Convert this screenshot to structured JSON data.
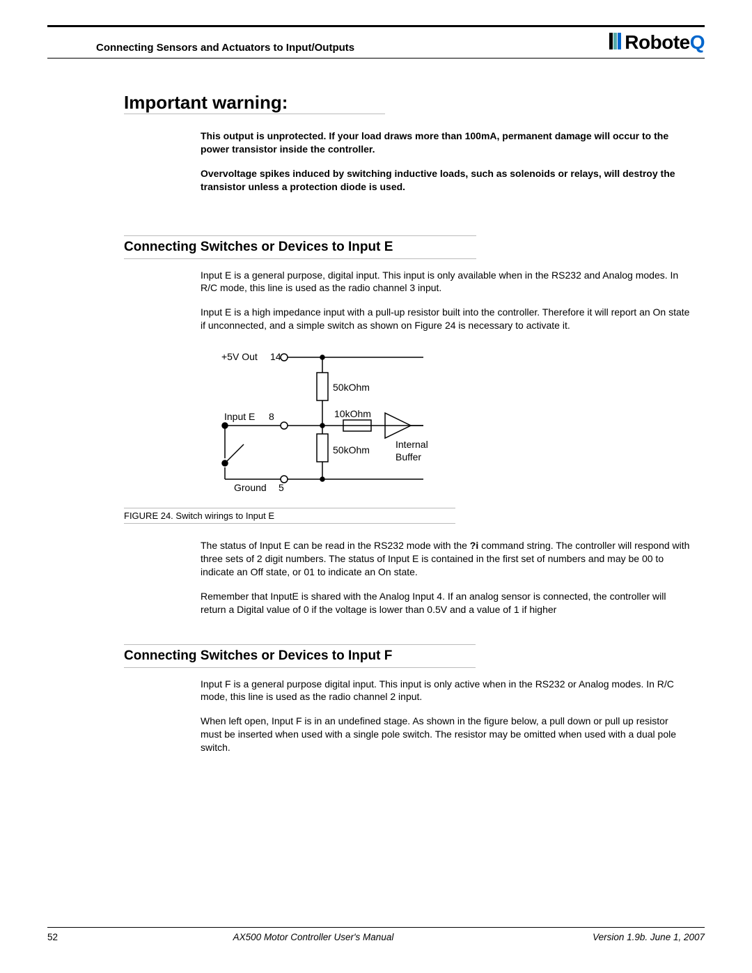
{
  "header": {
    "section_title": "Connecting Sensors and Actuators to Input/Outputs",
    "logo_text_a": "Robote",
    "logo_text_b": "Q"
  },
  "warning": {
    "heading": "Important warning:",
    "p1": "This output is unprotected. If your load draws more than 100mA, permanent damage will occur to the power transistor inside the controller.",
    "p2": "Overvoltage spikes induced by switching inductive loads, such as solenoids or relays, will destroy the transistor unless a protection diode is used."
  },
  "section_e": {
    "heading": "Connecting Switches or Devices to Input E",
    "p1": "Input E is a general purpose, digital input. This input is only available when in the RS232 and Analog modes. In R/C mode, this line is used as the radio channel 3 input.",
    "p2": "Input E is a high impedance input with a pull-up resistor built into the controller. Therefore it will report an On state if unconnected, and a simple switch as shown on Figure 24 is necessary to activate it.",
    "p3a": "The status of Input E can be read in the RS232 mode with the ",
    "p3_cmd": "?i",
    "p3b": " command string. The controller will respond with three sets of 2 digit numbers. The status of Input E is contained in the first set of numbers and may be 00 to indicate an Off state, or 01 to indicate an On state.",
    "p4": "Remember that InputE is shared with the Analog Input 4. If an analog sensor is connected, the controller will return a Digital value of 0 if the voltage is lower than 0.5V and a value of 1 if higher"
  },
  "figure": {
    "caption": "FIGURE 24.  Switch wirings to Input E",
    "labels": {
      "vout": "+5V Out",
      "vout_pin": "14",
      "input_e": "Input E",
      "input_e_pin": "8",
      "ground": "Ground",
      "ground_pin": "5",
      "r_top": "50kOhm",
      "r_mid": "10kOhm",
      "r_bot": "50kOhm",
      "buffer1": "Internal",
      "buffer2": "Buffer"
    }
  },
  "section_f": {
    "heading": "Connecting Switches or Devices to Input F",
    "p1": "Input F is a general purpose digital input. This input is only active when in the RS232 or Analog modes. In R/C mode, this line is used as the radio channel 2 input.",
    "p2": "When left open, Input F is in an undefined stage. As shown in the figure below, a pull down or pull up resistor must be inserted when used with a single pole switch. The resistor may be omitted when used with a dual pole switch."
  },
  "footer": {
    "page": "52",
    "center": "AX500 Motor Controller User's Manual",
    "right": "Version 1.9b. June 1, 2007"
  }
}
